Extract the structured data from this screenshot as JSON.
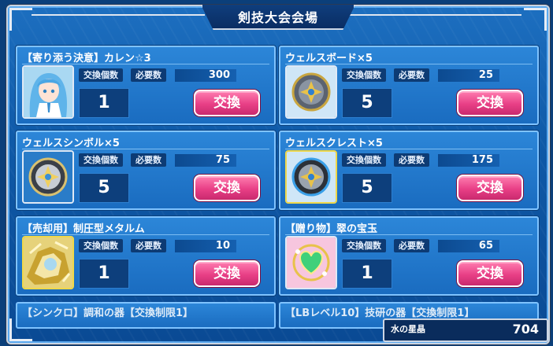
{
  "header": {
    "title": "剣技大会会場"
  },
  "labels": {
    "exchange_count": "交換個数",
    "required_count": "必要数",
    "exchange_button": "交換"
  },
  "items": [
    {
      "name": "【寄り添う決意】カレン☆3",
      "exchange_count": "1",
      "required": "300",
      "icon": "character-portrait-icon"
    },
    {
      "name": "ウェルスボード×5",
      "exchange_count": "5",
      "required": "25",
      "icon": "wealth-board-icon"
    },
    {
      "name": "ウェルスシンボル×5",
      "exchange_count": "5",
      "required": "75",
      "icon": "wealth-symbol-icon"
    },
    {
      "name": "ウェルスクレスト×5",
      "exchange_count": "5",
      "required": "175",
      "icon": "wealth-crest-icon"
    },
    {
      "name": "【売却用】制圧型メタルム",
      "exchange_count": "1",
      "required": "10",
      "icon": "metallum-icon"
    },
    {
      "name": "【贈り物】翠の宝玉",
      "exchange_count": "1",
      "required": "65",
      "icon": "green-jewel-icon"
    }
  ],
  "partial_items": [
    {
      "name": "【シンクロ】調和の器【交換制限1】"
    },
    {
      "name": "【LBレベル10】技研の器【交換制限1】"
    }
  ],
  "currency": {
    "label": "水の星晶",
    "value": "704"
  },
  "colors": {
    "panel": "#1a6cc0",
    "button": "#e83f86",
    "frame": "#0f5aa8"
  }
}
